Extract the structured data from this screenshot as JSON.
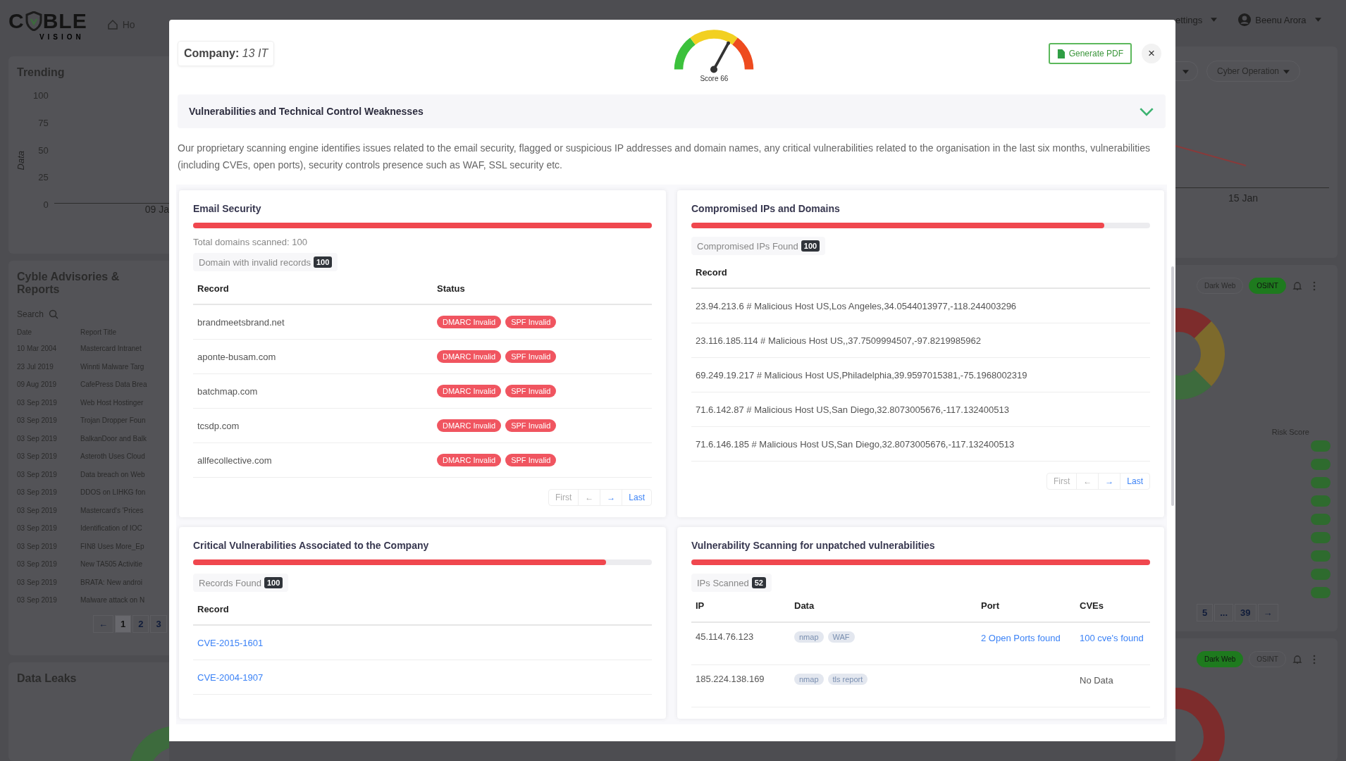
{
  "backdrop": {
    "logo": {
      "left": "C",
      "right": "BLE",
      "tagline": "VISION"
    },
    "nav_item": "Ho",
    "trending": {
      "title": "Trending",
      "ylabel": "Data",
      "yticks": [
        "100",
        "75",
        "50",
        "25",
        "0"
      ],
      "xlabel_left": "09 Ja",
      "xlabel_right": "15 Jan"
    },
    "advisories": {
      "title": "Cyble Advisories & Reports",
      "search": "Search",
      "columns": [
        "Date",
        "Report Title"
      ],
      "rows": [
        {
          "date": "10 Mar 2004",
          "title": "Mastercard Intranet"
        },
        {
          "date": "23 Jul 2019",
          "title": "Winnti Malware Targ"
        },
        {
          "date": "09 Aug 2019",
          "title": "CafePress Data Brea"
        },
        {
          "date": "03 Sep 2019",
          "title": "Web Host Hostinger"
        },
        {
          "date": "03 Sep 2019",
          "title": "Trojan Dropper Foun"
        },
        {
          "date": "03 Sep 2019",
          "title": "BalkanDoor and Balk"
        },
        {
          "date": "03 Sep 2019",
          "title": "Asteroth Uses Cloud"
        },
        {
          "date": "03 Sep 2019",
          "title": "Data breach on Web"
        },
        {
          "date": "03 Sep 2019",
          "title": "DDOS on LIHKG fon"
        },
        {
          "date": "03 Sep 2019",
          "title": "Mastercard's 'Prices"
        },
        {
          "date": "03 Sep 2019",
          "title": "Identification of IOC"
        },
        {
          "date": "03 Sep 2019",
          "title": "FIN8 Uses More_Ep"
        },
        {
          "date": "03 Sep 2019",
          "title": "New TA505 Activitie"
        },
        {
          "date": "03 Sep 2019",
          "title": "BRATA: New androi"
        },
        {
          "date": "03 Sep 2019",
          "title": "Malware attack on N"
        }
      ],
      "pages": [
        {
          "label": "←",
          "selected": false
        },
        {
          "label": "1",
          "selected": true
        },
        {
          "label": "2",
          "selected": false
        },
        {
          "label": "3",
          "selected": false
        }
      ]
    },
    "data_leaks": "Data Leaks",
    "settings": "ettings",
    "user": "Beenu Arora",
    "filter": "Cyber Operation",
    "toggle_top": [
      {
        "label": "Dark Web",
        "selected": false
      },
      {
        "label": "OSINT",
        "selected": true
      }
    ],
    "risk_score": "Risk Score",
    "right_pages": [
      "5",
      "...",
      "39",
      "→"
    ],
    "toggle_bottom": [
      {
        "label": "Dark Web",
        "selected": true
      },
      {
        "label": "OSINT",
        "selected": false
      }
    ]
  },
  "modal": {
    "company_label": "Company:",
    "company": "13 IT",
    "gauge": {
      "level": 0.66,
      "caption": "Score 66"
    },
    "generate_button": "Generate PDF",
    "close": "×",
    "section": {
      "title": "Vulnerabilities and Technical Control Weaknesses",
      "expanded": true,
      "description": "Our proprietary scanning engine identifies issues related to the email security, flagged or suspicious IP addresses and domain names, any critical vulnerabilities related to the organisation in the last six months, vulnerabilities (including CVEs, open ports), security controls presence such as WAF, SSL security etc."
    },
    "email": {
      "title": "Email Security",
      "level": 1.0,
      "summary": "Total domains scanned: 100",
      "chip": "Domain with invalid records",
      "count": "100",
      "columns": [
        "Record",
        "Status"
      ],
      "rows": [
        {
          "record": "brandmeetsbrand.net",
          "statuses": [
            "DMARC Invalid",
            "SPF Invalid"
          ]
        },
        {
          "record": "aponte-busam.com",
          "statuses": [
            "DMARC Invalid",
            "SPF Invalid"
          ]
        },
        {
          "record": "batchmap.com",
          "statuses": [
            "DMARC Invalid",
            "SPF Invalid"
          ]
        },
        {
          "record": "tcsdp.com",
          "statuses": [
            "DMARC Invalid",
            "SPF Invalid"
          ]
        },
        {
          "record": "allfecollective.com",
          "statuses": [
            "DMARC Invalid",
            "SPF Invalid"
          ]
        }
      ],
      "pager": [
        {
          "label": "First",
          "disabled": true
        },
        {
          "label": "←",
          "disabled": true
        },
        {
          "label": "→",
          "disabled": false
        },
        {
          "label": "Last",
          "disabled": false
        }
      ]
    },
    "compromised": {
      "title": "Compromised IPs and Domains",
      "level": 0.9,
      "chip": "Compromised IPs Found",
      "count": "100",
      "columns": [
        "Record"
      ],
      "rows": [
        "23.94.213.6 # Malicious Host US,Los Angeles,34.0544013977,-118.244003296",
        "23.116.185.114 # Malicious Host US,,37.7509994507,-97.8219985962",
        "69.249.19.217 # Malicious Host US,Philadelphia,39.9597015381,-75.1968002319",
        "71.6.142.87 # Malicious Host US,San Diego,32.8073005676,-117.132400513",
        "71.6.146.185 # Malicious Host US,San Diego,32.8073005676,-117.132400513"
      ],
      "pager": [
        {
          "label": "First",
          "disabled": true
        },
        {
          "label": "←",
          "disabled": true
        },
        {
          "label": "→",
          "disabled": false
        },
        {
          "label": "Last",
          "disabled": false
        }
      ]
    },
    "critical": {
      "title": "Critical Vulnerabilities Associated to the Company",
      "level": 0.9,
      "chip": "Records Found",
      "count": "100",
      "columns": [
        "Record"
      ],
      "rows": [
        "CVE-2015-1601",
        "CVE-2004-1907"
      ]
    },
    "scanning": {
      "title": "Vulnerability Scanning for unpatched vulnerabilities",
      "level": 1.0,
      "chip": "IPs Scanned",
      "count": "52",
      "columns": [
        "IP",
        "Data",
        "Port",
        "CVEs"
      ],
      "rows": [
        {
          "ip": "45.114.76.123",
          "tags": [
            "nmap",
            "WAF"
          ],
          "port": "2 Open Ports found",
          "cves_link": "100 cve's found"
        },
        {
          "ip": "185.224.138.169",
          "tags": [
            "nmap",
            "tls report"
          ],
          "cves": "No Data"
        }
      ]
    }
  }
}
